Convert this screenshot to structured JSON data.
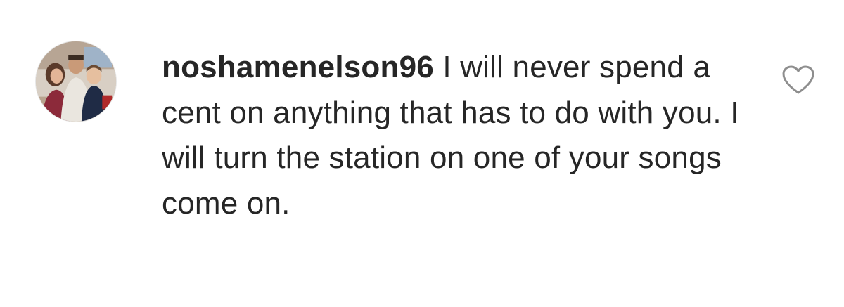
{
  "comment": {
    "username": "noshamenelson96",
    "body": "I will never spend a cent on anything that has to do with you. I will turn the station on one of your songs come on."
  },
  "icons": {
    "like": "heart-outline-icon",
    "avatar": "user-avatar-photo"
  },
  "colors": {
    "text": "#262626",
    "icon_stroke": "#8e8e8e",
    "background": "#ffffff"
  }
}
